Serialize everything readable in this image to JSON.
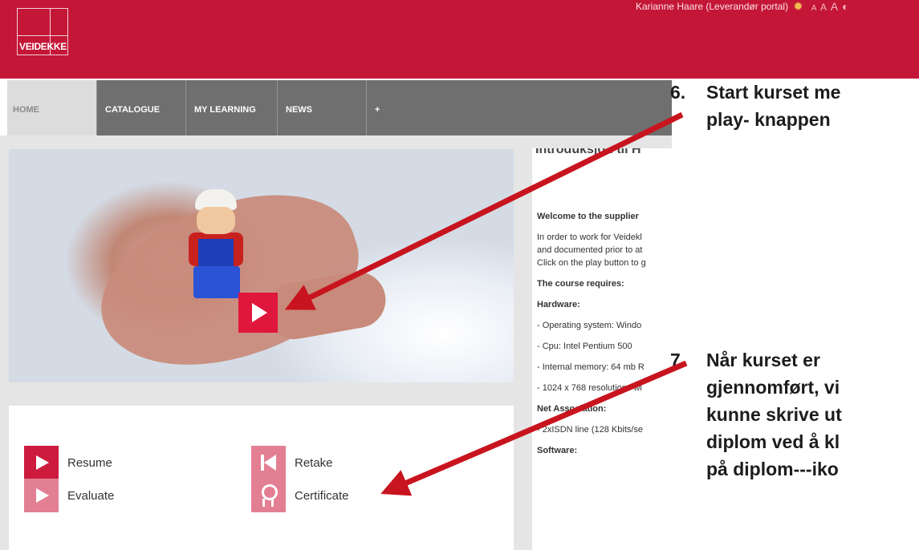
{
  "header": {
    "logo_text": "VEIDEKKE",
    "user": "Karianne Haare  (Leverandør portal)",
    "font_sizes": [
      "A",
      "A",
      "A"
    ]
  },
  "nav": {
    "items": [
      {
        "label": "HOME"
      },
      {
        "label": "CATALOGUE"
      },
      {
        "label": "MY LEARNING"
      },
      {
        "label": "NEWS"
      },
      {
        "label": "+"
      }
    ]
  },
  "course": {
    "title": "Introduksjon til H",
    "welcome": "Welcome to the supplier",
    "intro_lines": [
      "In order to work for Veidekl",
      "and documented prior to at",
      "Click on the play button to g"
    ],
    "requires": "The course requires:",
    "hardware_heading": "Hardware:",
    "hardware_items": [
      "- Operating system: Windo",
      "- Cpu: Intel Pentium 500",
      "- Internal memory: 64 mb R",
      "- 1024 x 768 resolutions wi"
    ],
    "net_heading": "Net Association:",
    "net_items": [
      "- 2xISDN line (128 Kbits/se"
    ],
    "software_heading": "Software:"
  },
  "actions": {
    "resume": "Resume",
    "retake": "Retake",
    "evaluate": "Evaluate",
    "certificate": "Certificate"
  },
  "callouts": {
    "step6_num": "6.",
    "step6_lines": [
      "Start kurset me",
      "play- knappen"
    ],
    "step7_num": "7.",
    "step7_lines": [
      "Når kurset er",
      "gjennomført, vi",
      "kunne skrive ut",
      "diplom ved å kl",
      "på diplom---iko"
    ]
  },
  "colors": {
    "brand_red": "#c41637",
    "icon_red": "#cc1b3d",
    "icon_pink": "#e37f93",
    "arrow": "#c8141e"
  },
  "icons": [
    "gear-icon",
    "contrast-icon",
    "play-icon",
    "resume-icon",
    "retake-icon",
    "evaluate-icon",
    "certificate-icon"
  ]
}
